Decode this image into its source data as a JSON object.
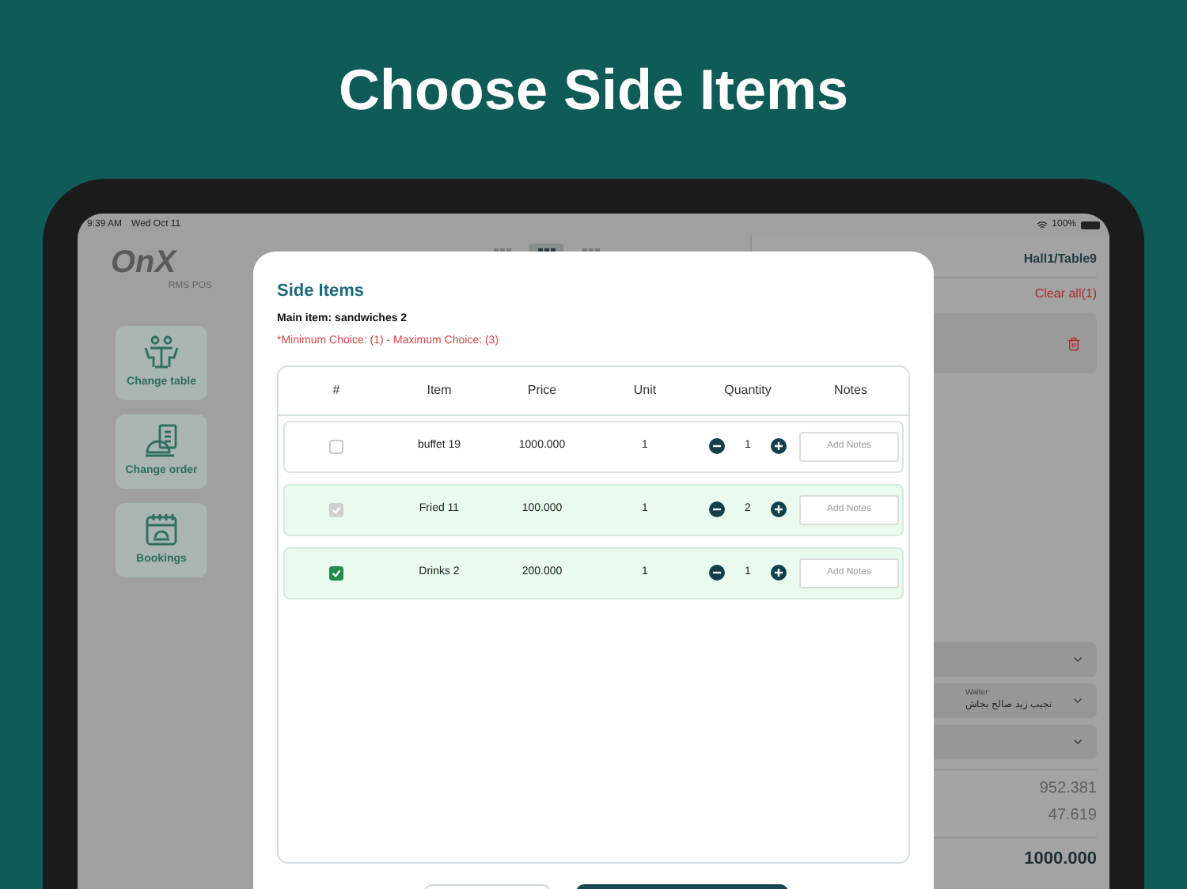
{
  "headline": "Choose Side Items",
  "status_bar": {
    "time": "9:39 AM",
    "date": "Wed Oct 11",
    "battery": "100%"
  },
  "logo": {
    "mark": "OnX",
    "subtitle": "RMS POS"
  },
  "sidebar": {
    "items": [
      {
        "label": "Change table"
      },
      {
        "label": "Change order"
      },
      {
        "label": "Bookings"
      }
    ]
  },
  "view_toggles": [
    {
      "selected": false
    },
    {
      "selected": true
    },
    {
      "selected": false
    }
  ],
  "order_panel": {
    "table": "Hall1/Table9",
    "clear_all": "Clear all(1)",
    "selects": [
      {
        "kind": "empty"
      },
      {
        "kind": "labeled",
        "label": "Waiter",
        "value": "نجيب زيد صالح بجاش"
      },
      {
        "kind": "empty"
      }
    ],
    "subtotals": [
      "952.381",
      "47.619"
    ],
    "total": "1000.000"
  },
  "modal": {
    "title": "Side Items",
    "main_item": "Main item: sandwiches 2",
    "constraint": "*Minimum Choice: (1) - Maximum Choice: (3)",
    "columns": [
      "#",
      "Item",
      "Price",
      "Unit",
      "Quantity",
      "Notes"
    ],
    "rows": [
      {
        "item": "buffet 19",
        "price": "1000.000",
        "unit": "1",
        "quantity": "1",
        "notes_placeholder": "Add Notes",
        "checked": false,
        "disabled": false,
        "selected": false
      },
      {
        "item": "Fried 11",
        "price": "100.000",
        "unit": "1",
        "quantity": "2",
        "notes_placeholder": "Add Notes",
        "checked": true,
        "disabled": true,
        "selected": true
      },
      {
        "item": "Drinks 2",
        "price": "200.000",
        "unit": "1",
        "quantity": "1",
        "notes_placeholder": "Add Notes",
        "checked": true,
        "disabled": false,
        "selected": true
      }
    ]
  }
}
